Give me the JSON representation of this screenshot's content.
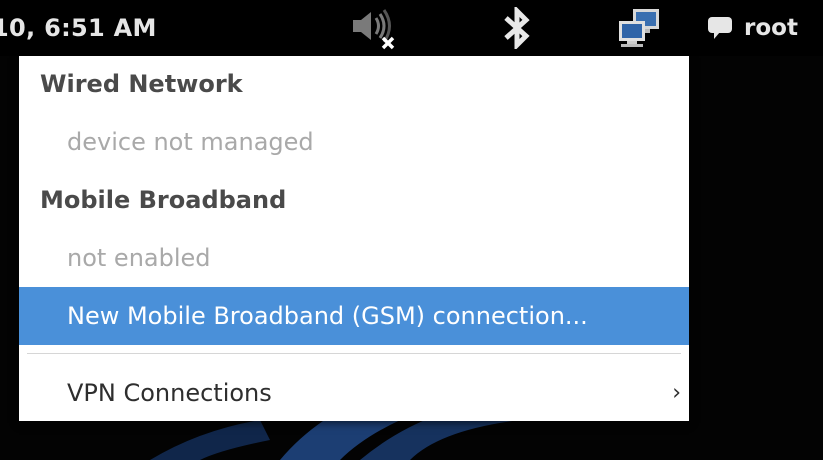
{
  "panel": {
    "clock": "10, 6:51 AM",
    "icons": {
      "volume": "volume-muted-icon",
      "bluetooth": "bluetooth-icon",
      "network": "network-wired-icon",
      "chat": "chat-bubble-icon"
    },
    "user_name": "root"
  },
  "network_menu": {
    "wired_header": "Wired Network",
    "wired_status": "device not managed",
    "mobile_header": "Mobile Broadband",
    "mobile_status": "not enabled",
    "new_connection_label": "New Mobile Broadband (GSM) connection...",
    "vpn_label": "VPN Connections",
    "vpn_arrow": "›"
  },
  "colors": {
    "highlight": "#4a90d9",
    "menu_background": "#ffffff",
    "panel_background": "#000000"
  }
}
